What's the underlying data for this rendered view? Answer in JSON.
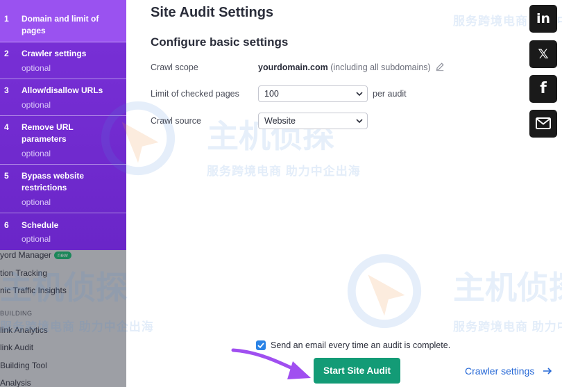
{
  "background_nav": {
    "items": [
      {
        "label": "yord Manager",
        "badge": "new"
      },
      {
        "label": "tion Tracking"
      },
      {
        "label": "nic Traffic Insights"
      },
      {
        "label": "link Analytics"
      },
      {
        "label": "link Audit"
      },
      {
        "label": "Building Tool"
      },
      {
        "label": "Analysis"
      }
    ],
    "section_label": "BUILDING"
  },
  "steps": [
    {
      "num": "1",
      "title": "Domain and limit of pages",
      "subtitle": "",
      "active": true
    },
    {
      "num": "2",
      "title": "Crawler settings",
      "subtitle": "optional"
    },
    {
      "num": "3",
      "title": "Allow/disallow URLs",
      "subtitle": "optional"
    },
    {
      "num": "4",
      "title": "Remove URL parameters",
      "subtitle": "optional"
    },
    {
      "num": "5",
      "title": "Bypass website restrictions",
      "subtitle": "optional"
    },
    {
      "num": "6",
      "title": "Schedule",
      "subtitle": "optional"
    }
  ],
  "main": {
    "title": "Site Audit Settings",
    "section_title": "Configure basic settings",
    "crawl_scope_label": "Crawl scope",
    "crawl_scope_domain": "yourdomain.com",
    "crawl_scope_note": "(including all subdomains)",
    "limit_label": "Limit of checked pages",
    "limit_value": "100",
    "limit_suffix": "per audit",
    "source_label": "Crawl source",
    "source_value": "Website"
  },
  "footer": {
    "email_label": "Send an email every time an audit is complete.",
    "email_checked": true,
    "start_button": "Start Site Audit",
    "crawler_link": "Crawler settings"
  },
  "share": {
    "linkedin": "in",
    "x": "𝕏",
    "facebook": "f"
  },
  "watermark": {
    "big_text": "主机侦探",
    "small_text": "服务跨境电商 助力中企出海"
  },
  "colors": {
    "steps_bg": "#6a26c8",
    "step_active": "#9a52f0",
    "start_button": "#139b76",
    "link": "#2668d6",
    "checkbox": "#2a83e6"
  }
}
